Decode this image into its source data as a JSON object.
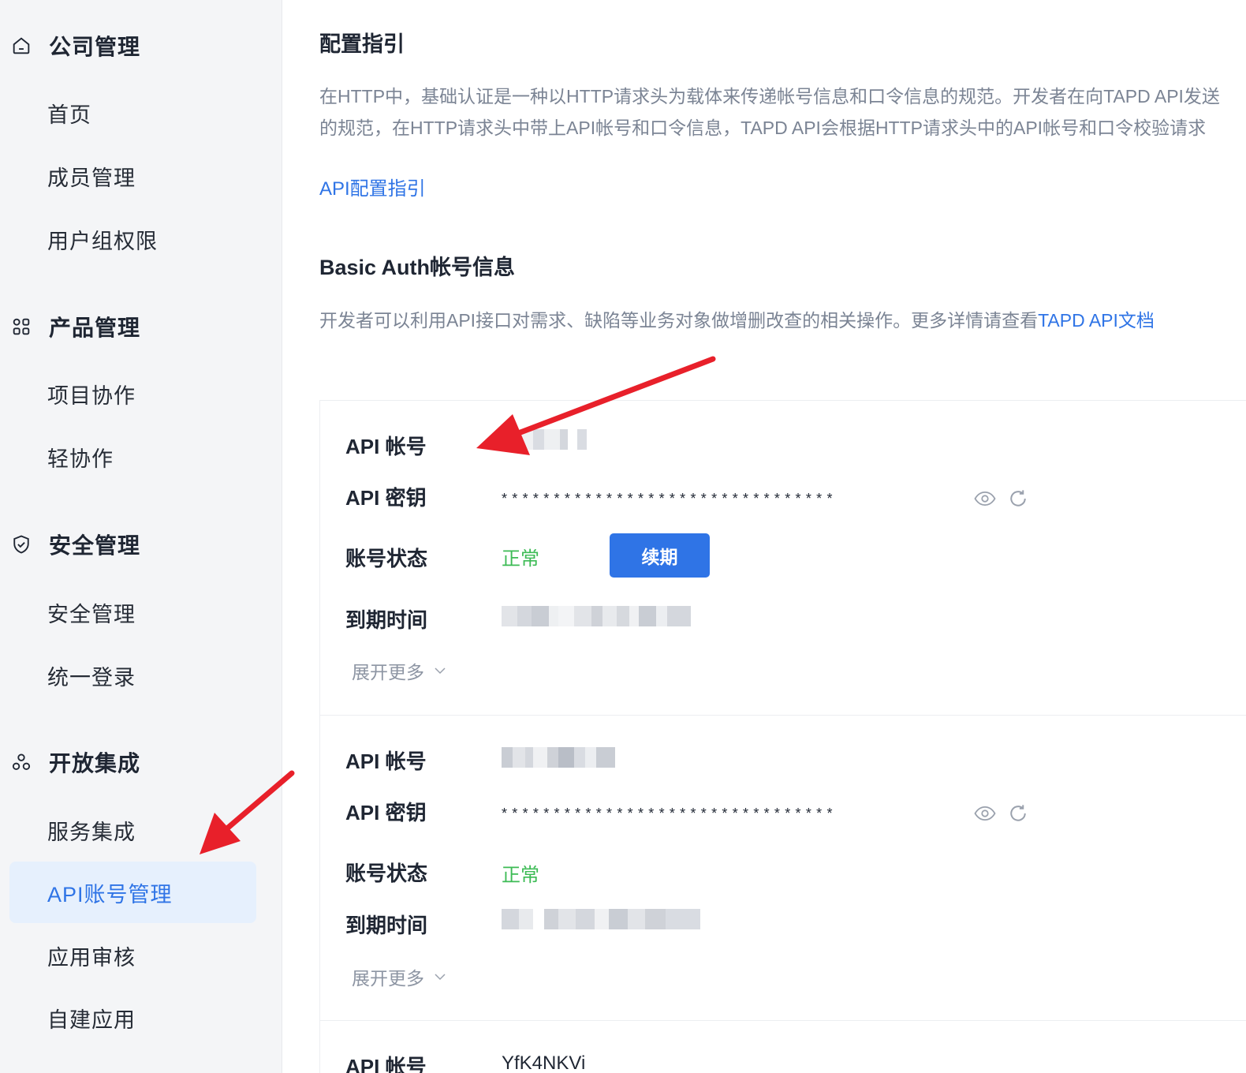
{
  "sidebar": {
    "groups": [
      {
        "label": "公司管理",
        "icon": "home-icon",
        "items": [
          {
            "label": "首页"
          },
          {
            "label": "成员管理"
          },
          {
            "label": "用户组权限"
          }
        ]
      },
      {
        "label": "产品管理",
        "icon": "grid-icon",
        "items": [
          {
            "label": "项目协作"
          },
          {
            "label": "轻协作"
          }
        ]
      },
      {
        "label": "安全管理",
        "icon": "shield-check-icon",
        "items": [
          {
            "label": "安全管理"
          },
          {
            "label": "统一登录"
          }
        ]
      },
      {
        "label": "开放集成",
        "icon": "connection-icon",
        "items": [
          {
            "label": "服务集成"
          },
          {
            "label": "API账号管理"
          },
          {
            "label": "应用审核"
          },
          {
            "label": "自建应用"
          }
        ]
      }
    ],
    "active_item": "API账号管理"
  },
  "main": {
    "guide_title": "配置指引",
    "guide_para_line1": "在HTTP中，基础认证是一种以HTTP请求头为载体来传递帐号信息和口令信息的规范。开发者在向TAPD API发送",
    "guide_para_line2": "的规范，在HTTP请求头中带上API帐号和口令信息，TAPD API会根据HTTP请求头中的API帐号和口令校验请求",
    "guide_link": "API配置指引",
    "auth_title": "Basic Auth帐号信息",
    "auth_desc": "开发者可以利用API接口对需求、缺陷等业务对象做增删改查的相关操作。更多详情请查看",
    "auth_desc_link": "TAPD API文档"
  },
  "labels": {
    "account": "API 帐号",
    "secret": "API 密钥",
    "status": "账号状态",
    "expire": "到期时间",
    "expand_more": "展开更多",
    "renew": "续期"
  },
  "accounts": [
    {
      "status": "正常",
      "secret": "********************************",
      "account_value": "",
      "expire_value": ""
    },
    {
      "status": "正常",
      "secret": "********************************",
      "account_value": "",
      "expire_value": ""
    },
    {
      "account_value": "YfK4NKVi"
    }
  ],
  "colors": {
    "accent": "#2f74e6",
    "status_ok": "#3dbb55",
    "annotation_arrow": "#e8202a"
  }
}
